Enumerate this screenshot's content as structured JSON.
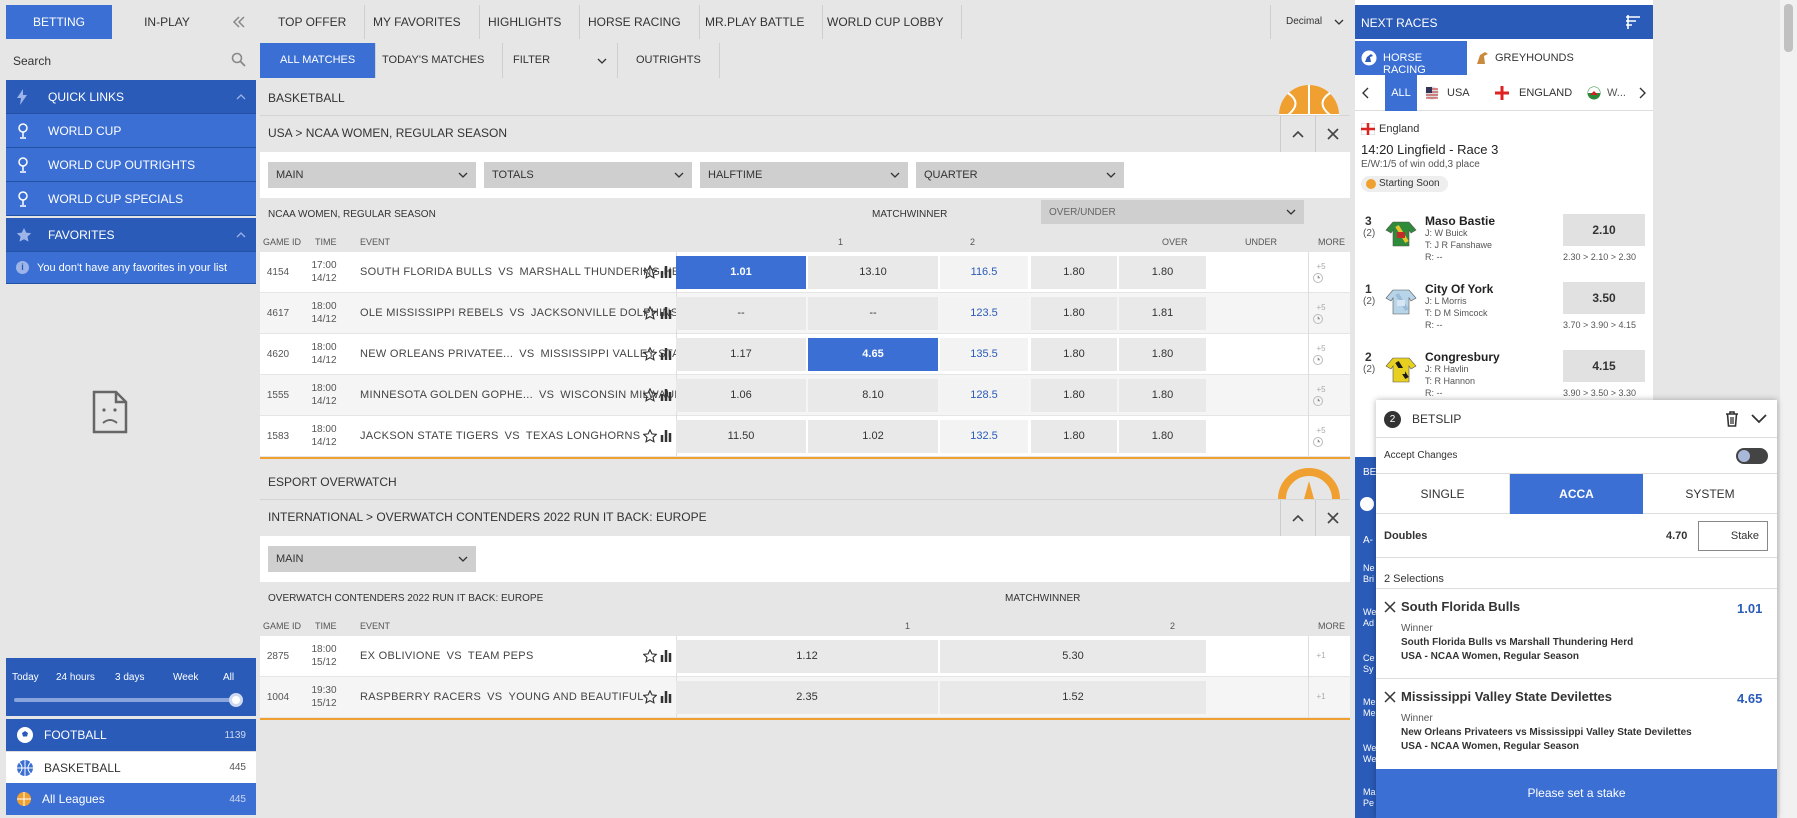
{
  "left": {
    "tabs": {
      "betting": "BETTING",
      "inplay": "IN-PLAY"
    },
    "search_placeholder": "Search",
    "quick_links": "QUICK LINKS",
    "links": [
      "WORLD CUP",
      "WORLD CUP OUTRIGHTS",
      "WORLD CUP SPECIALS"
    ],
    "favorites": "FAVORITES",
    "no_favorites": "You don't have any favorites in your list",
    "time_filters": [
      "Today",
      "24 hours",
      "3 days",
      "Week",
      "All"
    ],
    "time_slider_value": 1.0,
    "sports": [
      {
        "name": "FOOTBALL",
        "count": "1139"
      },
      {
        "name": "BASKETBALL",
        "count": "445"
      },
      {
        "name": "All Leagues",
        "count": "445"
      }
    ]
  },
  "nav": {
    "tabs": [
      "TOP OFFER",
      "MY FAVORITES",
      "HIGHLIGHTS",
      "HORSE RACING",
      "MR.PLAY BATTLE",
      "WORLD CUP LOBBY"
    ],
    "odds_format": "Decimal",
    "subtabs": [
      "ALL MATCHES",
      "TODAY'S MATCHES",
      "FILTER",
      "OUTRIGHTS"
    ]
  },
  "basketball": {
    "sport": "BASKETBALL",
    "breadcrumb": "USA > NCAA WOMEN, REGULAR SEASON",
    "markets": [
      "MAIN",
      "TOTALS",
      "HALFTIME",
      "QUARTER"
    ],
    "league": "NCAA WOMEN, REGULAR SEASON",
    "matchwinner": "MATCHWINNER",
    "ou_select": "OVER/UNDER",
    "headers": {
      "gid": "GAME ID",
      "time": "TIME",
      "event": "EVENT",
      "one": "1",
      "two": "2",
      "over": "OVER",
      "under": "UNDER",
      "more": "MORE"
    },
    "vs": "VS",
    "games": [
      {
        "id": "4154",
        "time": "17:00",
        "date": "14/12",
        "home": "SOUTH FLORIDA BULLS",
        "away": "MARSHALL THUNDERING HERD",
        "o1": "1.01",
        "o2": "13.10",
        "line": "116.5",
        "over": "1.80",
        "under": "1.80",
        "more": "+5"
      },
      {
        "id": "4617",
        "time": "18:00",
        "date": "14/12",
        "home": "OLE MISSISSIPPI REBELS",
        "away": "JACKSONVILLE DOLPHINS",
        "o1": "--",
        "o2": "--",
        "line": "123.5",
        "over": "1.80",
        "under": "1.81",
        "more": "+5"
      },
      {
        "id": "4620",
        "time": "18:00",
        "date": "14/12",
        "home": "NEW ORLEANS PRIVATEE...",
        "away": "MISSISSIPPI VALLEY STATE DEVILETT...",
        "o1": "1.17",
        "o2": "4.65",
        "line": "135.5",
        "over": "1.80",
        "under": "1.80",
        "more": "+5"
      },
      {
        "id": "1555",
        "time": "18:00",
        "date": "14/12",
        "home": "MINNESOTA GOLDEN GOPHE...",
        "away": "WISCONSIN MILWAUKEE PANTHE...",
        "o1": "1.06",
        "o2": "8.10",
        "line": "128.5",
        "over": "1.80",
        "under": "1.80",
        "more": "+5"
      },
      {
        "id": "1583",
        "time": "18:00",
        "date": "14/12",
        "home": "JACKSON STATE TIGERS",
        "away": "TEXAS LONGHORNS",
        "o1": "11.50",
        "o2": "1.02",
        "line": "132.5",
        "over": "1.80",
        "under": "1.80",
        "more": "+5"
      }
    ]
  },
  "esport": {
    "sport": "ESPORT OVERWATCH",
    "breadcrumb": "INTERNATIONAL > OVERWATCH CONTENDERS 2022 RUN IT BACK: EUROPE",
    "market": "MAIN",
    "league": "OVERWATCH CONTENDERS 2022 RUN IT BACK: EUROPE",
    "matchwinner": "MATCHWINNER",
    "headers": {
      "gid": "GAME ID",
      "time": "TIME",
      "event": "EVENT",
      "one": "1",
      "two": "2",
      "more": "MORE"
    },
    "vs": "VS",
    "games": [
      {
        "id": "2875",
        "time": "18:00",
        "date": "15/12",
        "home": "EX OBLIVIONE",
        "away": "TEAM PEPS",
        "o1": "1.12",
        "o2": "5.30",
        "more": "+1"
      },
      {
        "id": "1004",
        "time": "19:30",
        "date": "15/12",
        "home": "RASPBERRY RACERS",
        "away": "YOUNG AND BEAUTIFUL",
        "o1": "2.35",
        "o2": "1.52",
        "more": "+1"
      }
    ]
  },
  "races": {
    "title": "NEXT RACES",
    "tabs": [
      "HORSE RACING",
      "GREYHOUNDS"
    ],
    "regions": [
      "ALL",
      "USA",
      "ENGLAND",
      "W..."
    ],
    "country": "England",
    "race_title": "14:20 Lingfield - Race 3",
    "terms": "E/W:1/5 of win odd,3 place",
    "status": "Starting Soon",
    "runners": [
      {
        "num": "3",
        "draw": "(2)",
        "name": "Maso Bastie",
        "jockey": "J: W Buick",
        "trainer": "T: J R Fanshawe",
        "rating": "R: --",
        "price": "2.10",
        "history": "2.30 > 2.10 > 2.30"
      },
      {
        "num": "1",
        "draw": "(2)",
        "name": "City Of York",
        "jockey": "J: L Morris",
        "trainer": "T: D M Simcock",
        "rating": "R: --",
        "price": "3.50",
        "history": "3.70 > 3.90 > 4.15"
      },
      {
        "num": "2",
        "draw": "(2)",
        "name": "Congresbury",
        "jockey": "J: R Havlin",
        "trainer": "T: R Hannon",
        "rating": "R: --",
        "price": "4.15",
        "history": "3.90 > 3.50 > 3.30"
      }
    ],
    "behind": {
      "bet": "BE",
      "a": "A-",
      "items": [
        "Ne Bri",
        "We Ad",
        "Ce Sy",
        "Me Me",
        "We We",
        "Ma Pe"
      ]
    }
  },
  "betslip": {
    "count": "2",
    "title": "BETSLIP",
    "accept_changes": "Accept Changes",
    "tabs": [
      "SINGLE",
      "ACCA",
      "SYSTEM"
    ],
    "bet_type": "Doubles",
    "bet_odds": "4.70",
    "stake_placeholder": "Stake",
    "selections_label": "2 Selections",
    "selections": [
      {
        "team": "South Florida Bulls",
        "odds": "1.01",
        "market": "Winner",
        "event": "South Florida Bulls vs Marshall Thundering Herd",
        "league": "USA - NCAA Women, Regular Season"
      },
      {
        "team": "Mississippi Valley State Devilettes",
        "odds": "4.65",
        "market": "Winner",
        "event": "New Orleans Privateers vs Mississippi Valley State Devilettes",
        "league": "USA - NCAA Women, Regular Season"
      }
    ],
    "cta": "Please set a stake"
  },
  "colors": {
    "accent": "#3b6fd4",
    "accent_dark": "#2a5bb8",
    "orange": "#f0a030",
    "background": "#e6e6e6"
  }
}
